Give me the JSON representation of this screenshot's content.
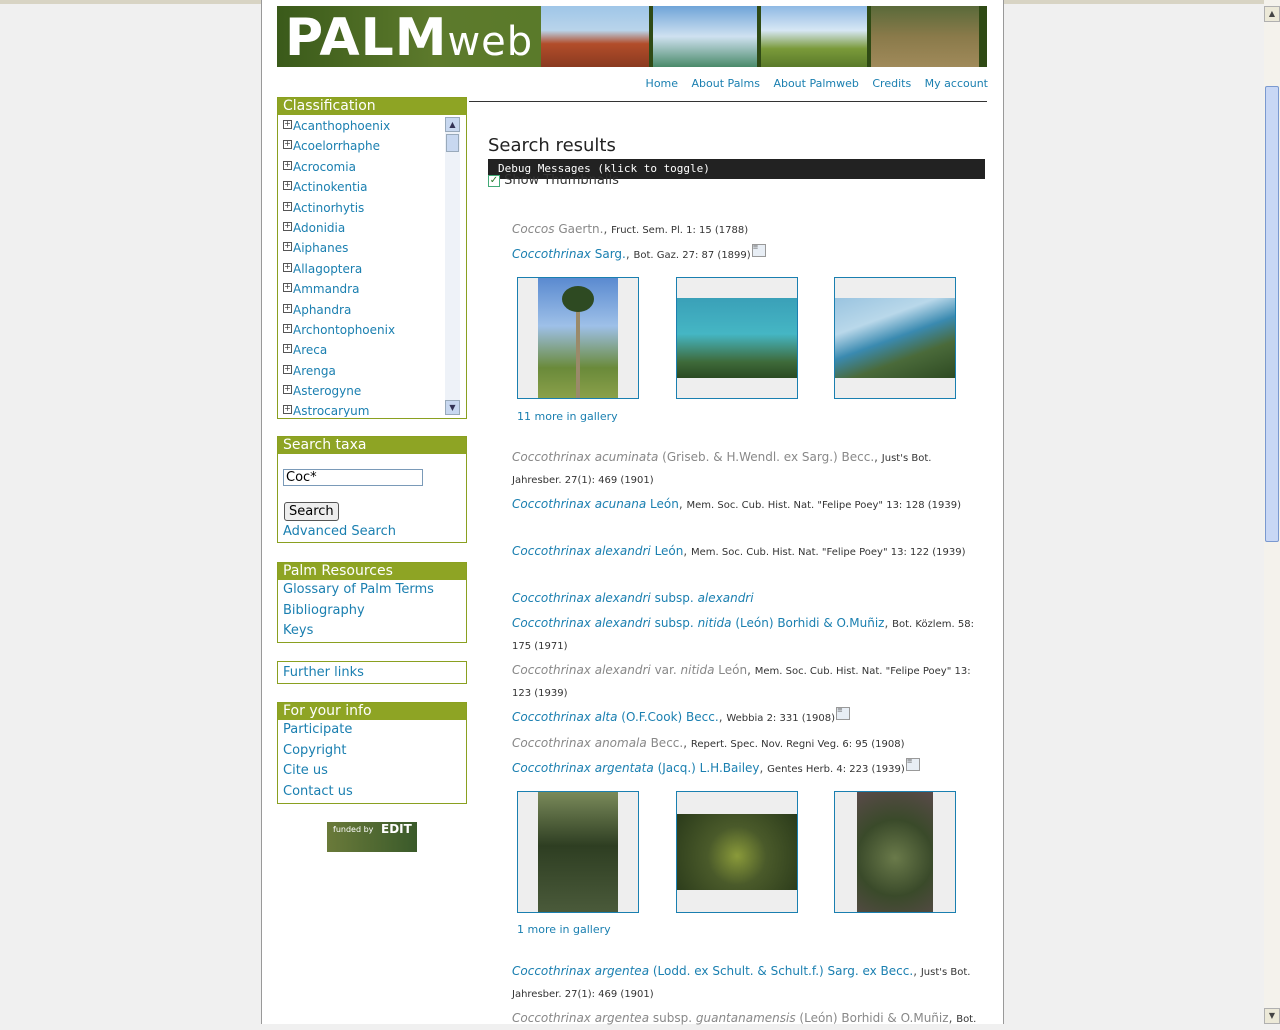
{
  "banner": {
    "logo_bold": "PALM",
    "logo_light": "web"
  },
  "nav": [
    "Home",
    "About Palms",
    "About Palmweb",
    "Credits",
    "My account"
  ],
  "classification": {
    "title": "Classification",
    "items": [
      "Acanthophoenix",
      "Acoelorrhaphe",
      "Acrocomia",
      "Actinokentia",
      "Actinorhytis",
      "Adonidia",
      "Aiphanes",
      "Allagoptera",
      "Ammandra",
      "Aphandra",
      "Archontophoenix",
      "Areca",
      "Arenga",
      "Asterogyne",
      "Astrocaryum"
    ]
  },
  "search": {
    "title": "Search taxa",
    "value": "Coc*",
    "button": "Search",
    "advanced": "Advanced Search"
  },
  "resources": {
    "title": "Palm Resources",
    "links": [
      "Glossary of Palm Terms",
      "Bibliography",
      "Keys"
    ]
  },
  "further": {
    "label": "Further links"
  },
  "info": {
    "title": "For your info",
    "links": [
      "Participate",
      "Copyright",
      "Cite us",
      "Contact us"
    ]
  },
  "funded": {
    "text": "funded by",
    "brand": "EDIT"
  },
  "main": {
    "title": "Search results",
    "debug": "Debug Messages (klick to toggle)",
    "thumbs_label": "Show Thumbnails",
    "results": [
      {
        "name": "Coccos",
        "author": "Gaertn.",
        "cit": "Fruct. Sem. Pl. 1: 15 (1788)",
        "accepted": false
      },
      {
        "name": "Coccothrinax",
        "author": "Sarg.",
        "cit": "Bot. Gaz. 27: 87 (1899)",
        "accepted": true
      },
      {
        "name": "Coccothrinax acuminata",
        "author": "(Griseb. & H.Wendl. ex Sarg.) Becc.",
        "cit": "Just's Bot. Jahresber. 27(1): 469 (1901)",
        "accepted": false
      },
      {
        "name": "Coccothrinax acunana",
        "author": "León",
        "cit": "Mem. Soc. Cub. Hist. Nat. \"Felipe Poey\" 13: 128 (1939)",
        "accepted": true
      },
      {
        "name": "Coccothrinax alexandri",
        "author": "León",
        "cit": "Mem. Soc. Cub. Hist. Nat. \"Felipe Poey\" 13: 122 (1939)",
        "accepted": true
      },
      {
        "name": "Coccothrinax alexandri",
        "rank": "subsp.",
        "infra": "alexandri",
        "author": "",
        "cit": "",
        "accepted": true
      },
      {
        "name": "Coccothrinax alexandri",
        "rank": "subsp.",
        "infra": "nitida",
        "author": "(León) Borhidi & O.Muñiz",
        "cit": "Bot. Közlem. 58: 175 (1971)",
        "accepted": true
      },
      {
        "name": "Coccothrinax alexandri",
        "rank": "var.",
        "infra": "nitida",
        "author": "León",
        "cit": "Mem. Soc. Cub. Hist. Nat. \"Felipe Poey\" 13: 123 (1939)",
        "accepted": false
      },
      {
        "name": "Coccothrinax alta",
        "author": "(O.F.Cook) Becc.",
        "cit": "Webbia 2: 331 (1908)",
        "accepted": true
      },
      {
        "name": "Coccothrinax anomala",
        "author": "Becc.",
        "cit": "Repert. Spec. Nov. Regni Veg. 6: 95 (1908)",
        "accepted": false
      },
      {
        "name": "Coccothrinax argentata",
        "author": "(Jacq.) L.H.Bailey",
        "cit": "Gentes Herb. 4: 223 (1939)",
        "accepted": true
      },
      {
        "name": "Coccothrinax argentea",
        "author": "(Lodd. ex Schult. & Schult.f.) Sarg. ex Becc.",
        "cit": "Just's Bot. Jahresber. 27(1): 469 (1901)",
        "accepted": true
      },
      {
        "name": "Coccothrinax argentea",
        "rank": "subsp.",
        "infra": "guantanamensis",
        "author": "(León) Borhidi & O.Muñiz",
        "cit": "Bot.",
        "accepted": false
      }
    ],
    "gallery1_more": "11 more in gallery",
    "gallery2_more": "1 more in gallery"
  },
  "colors": {
    "accent": "#8ea424",
    "link": "#1a7fb0"
  }
}
